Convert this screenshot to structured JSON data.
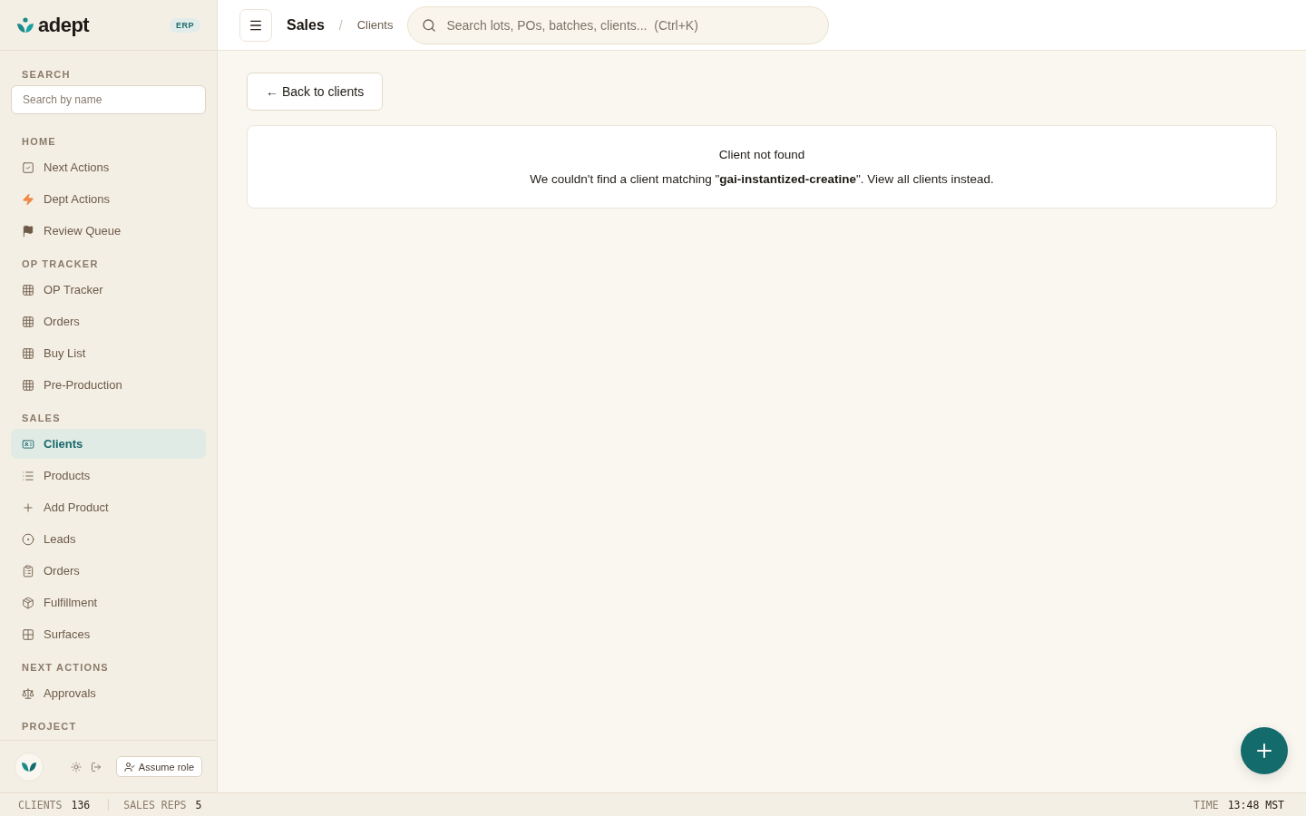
{
  "brand": {
    "name": "adept",
    "badge": "ERP"
  },
  "sidebar": {
    "search": {
      "label": "SEARCH",
      "placeholder": "Search by name"
    },
    "sections": [
      {
        "title": "HOME",
        "items": [
          {
            "label": "Next Actions",
            "kind": "check",
            "selected": false
          },
          {
            "label": "Dept Actions",
            "kind": "bolt",
            "selected": false
          },
          {
            "label": "Review Queue",
            "kind": "flag",
            "selected": false
          }
        ]
      },
      {
        "title": "OP TRACKER",
        "items": [
          {
            "label": "OP Tracker",
            "kind": "table",
            "selected": false
          },
          {
            "label": "Orders",
            "kind": "table",
            "selected": false
          },
          {
            "label": "Buy List",
            "kind": "table",
            "selected": false
          },
          {
            "label": "Pre-Production",
            "kind": "table",
            "selected": false
          }
        ]
      },
      {
        "title": "SALES",
        "items": [
          {
            "label": "Clients",
            "kind": "card",
            "selected": true
          },
          {
            "label": "Products",
            "kind": "list",
            "selected": false
          },
          {
            "label": "Add Product",
            "kind": "plus",
            "selected": false
          },
          {
            "label": "Leads",
            "kind": "target",
            "selected": false
          },
          {
            "label": "Orders",
            "kind": "clipboard",
            "selected": false
          },
          {
            "label": "Fulfillment",
            "kind": "box",
            "selected": false
          },
          {
            "label": "Surfaces",
            "kind": "grid",
            "selected": false
          }
        ]
      },
      {
        "title": "NEXT ACTIONS",
        "items": [
          {
            "label": "Approvals",
            "kind": "scale",
            "selected": false
          }
        ]
      },
      {
        "title": "PROJECT"
      }
    ],
    "footer": {
      "assume_role": "Assume role"
    }
  },
  "header": {
    "breadcrumb": [
      "Sales",
      "Clients"
    ],
    "separator": "/",
    "search_placeholder": "Search lots, POs, batches, clients...  (Ctrl+K)"
  },
  "main": {
    "back_button": "← Back to clients",
    "notice": {
      "title": "Client not found",
      "message": "We couldn't find a client matching \"**gai-instantized-creatine**\". View all clients instead."
    }
  },
  "status_bar": {
    "left": [
      {
        "label": "CLIENTS",
        "value": "136"
      },
      {
        "label": "SALES REPS",
        "value": "5"
      }
    ],
    "right": {
      "label": "TIME",
      "value": "13:48 MST"
    }
  }
}
